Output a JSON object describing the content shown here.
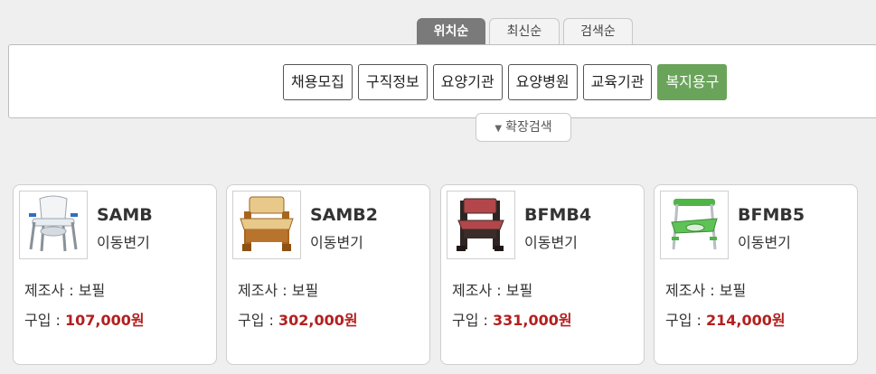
{
  "sort_tabs": [
    {
      "label": "위치순",
      "active": true
    },
    {
      "label": "최신순",
      "active": false
    },
    {
      "label": "검색순",
      "active": false
    }
  ],
  "categories": [
    {
      "label": "채용모집",
      "active": false
    },
    {
      "label": "구직정보",
      "active": false
    },
    {
      "label": "요양기관",
      "active": false
    },
    {
      "label": "요양병원",
      "active": false
    },
    {
      "label": "교육기관",
      "active": false
    },
    {
      "label": "복지용구",
      "active": true
    }
  ],
  "expand_search": {
    "label": "확장검색",
    "icon": "caret-down-icon"
  },
  "colors": {
    "accent_green": "#6aa45a",
    "price_red": "#b3201f",
    "active_tab": "#7a7a7a"
  },
  "products": [
    {
      "name": "SAMB",
      "category": "이동변기",
      "maker_label": "제조사 : 보필",
      "buy_label": "구입 : ",
      "price": "107,000원",
      "image": "folding-commode-chair"
    },
    {
      "name": "SAMB2",
      "category": "이동변기",
      "maker_label": "제조사 : 보필",
      "buy_label": "구입 : ",
      "price": "302,000원",
      "image": "wooden-commode-chair"
    },
    {
      "name": "BFMB4",
      "category": "이동변기",
      "maker_label": "제조사 : 보필",
      "buy_label": "구입 : ",
      "price": "331,000원",
      "image": "dark-wood-commode-chair"
    },
    {
      "name": "BFMB5",
      "category": "이동변기",
      "maker_label": "제조사 : 보필",
      "buy_label": "구입 : ",
      "price": "214,000원",
      "image": "green-shower-commode-chair"
    }
  ]
}
